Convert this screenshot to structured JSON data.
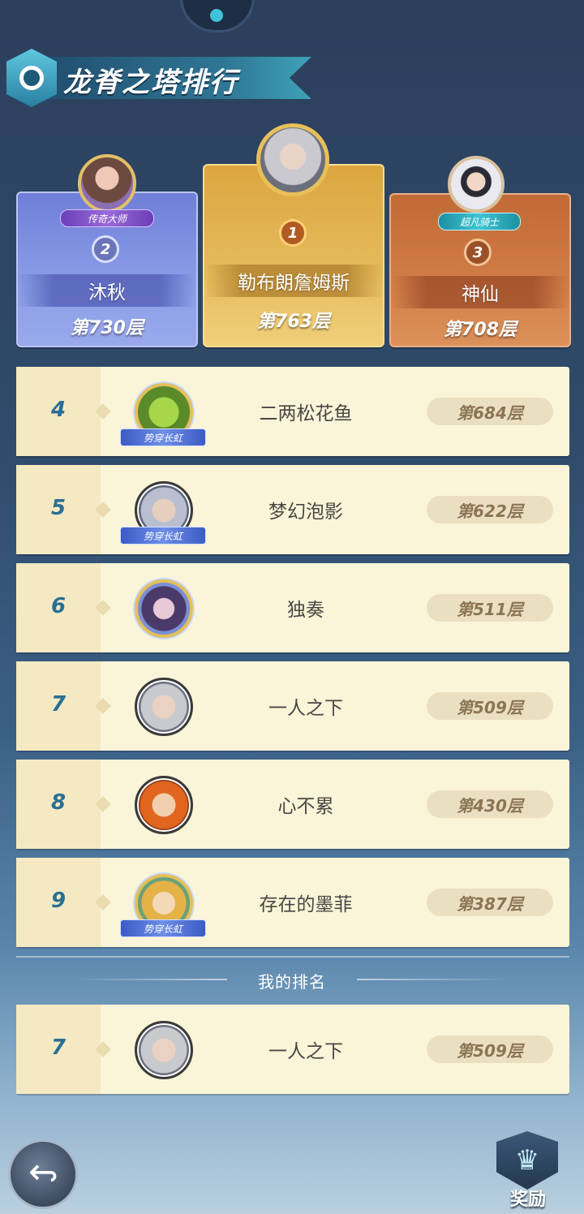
{
  "title": "龙脊之塔排行",
  "podium": [
    {
      "rank": "1",
      "name": "勒布朗詹姆斯",
      "floor": "第763层",
      "title_badge": ""
    },
    {
      "rank": "2",
      "name": "沐秋",
      "floor": "第730层",
      "title_badge": "传奇大师"
    },
    {
      "rank": "3",
      "name": "神仙",
      "floor": "第708层",
      "title_badge": "超凡骑士"
    }
  ],
  "rows": [
    {
      "rank": "4",
      "name": "二两松花鱼",
      "floor": "第684层",
      "badge": "势穿长虹"
    },
    {
      "rank": "5",
      "name": "梦幻泡影",
      "floor": "第622层",
      "badge": "势穿长虹"
    },
    {
      "rank": "6",
      "name": "独奏",
      "floor": "第511层",
      "badge": ""
    },
    {
      "rank": "7",
      "name": "一人之下",
      "floor": "第509层",
      "badge": ""
    },
    {
      "rank": "8",
      "name": "心不累",
      "floor": "第430层",
      "badge": ""
    },
    {
      "rank": "9",
      "name": "存在的墨菲",
      "floor": "第387层",
      "badge": "势穿长虹"
    }
  ],
  "my_rank_label": "我的排名",
  "my_rank": {
    "rank": "7",
    "name": "一人之下",
    "floor": "第509层"
  },
  "reward_label": "奖励",
  "icons": {
    "back": "back-arrow-icon",
    "reward": "crown-icon",
    "title": "tower-emblem-icon"
  }
}
